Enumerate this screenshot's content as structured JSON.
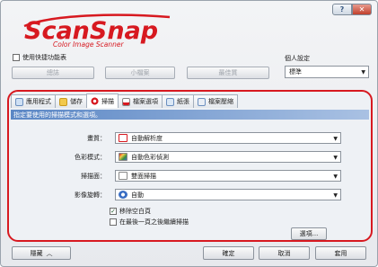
{
  "titlebar": {
    "help_icon": "?",
    "close_icon": "✕"
  },
  "logo": {
    "main": "ScanSnap",
    "sub": "Color Image Scanner"
  },
  "quick_menu": {
    "label": "使用快捷功能表",
    "checked": false
  },
  "modes": [
    "總誌",
    "小檔案",
    "最佳質"
  ],
  "profile": {
    "label": "個人設定",
    "value": "標準"
  },
  "tabs": [
    "應用程式",
    "儲存",
    "掃描",
    "檔案選項",
    "紙張",
    "檔案壓縮"
  ],
  "section_header": "指定要使用的掃描模式和選項。",
  "rows": [
    {
      "label": "畫質：",
      "value": "自動解析度"
    },
    {
      "label": "色彩模式：",
      "value": "自動色彩偵測"
    },
    {
      "label": "掃描面：",
      "value": "雙面掃描"
    },
    {
      "label": "影像旋轉：",
      "value": "自動"
    }
  ],
  "checkboxes": [
    {
      "label": "移除空白頁",
      "checked": true
    },
    {
      "label": "在最後一頁之後繼續掃描",
      "checked": false
    }
  ],
  "options_button": "選項...",
  "bottom": {
    "hide": "隱藏",
    "ok": "確定",
    "cancel": "取消",
    "apply": "套用"
  },
  "colors": {
    "accent_red": "#d71920",
    "logo_red": "#d71920",
    "header_blue": "#5b87c5"
  }
}
